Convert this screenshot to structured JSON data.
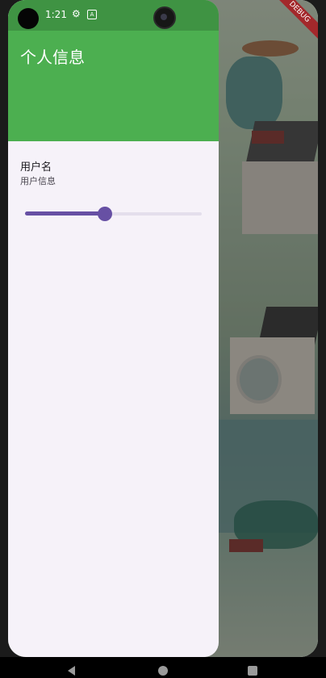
{
  "status_bar": {
    "time": "1:21",
    "icons": [
      "settings-gear-icon",
      "a-notification-icon"
    ]
  },
  "debug_banner": "DEBUG",
  "drawer": {
    "header_title": "个人信息",
    "header_color": "#4caf50",
    "tile": {
      "title": "用户名",
      "subtitle": "用户信息"
    },
    "slider": {
      "value": 0.45,
      "accent": "#6750a4"
    }
  },
  "nav_bar": {
    "buttons": [
      "back-icon",
      "home-icon",
      "recents-icon"
    ]
  }
}
